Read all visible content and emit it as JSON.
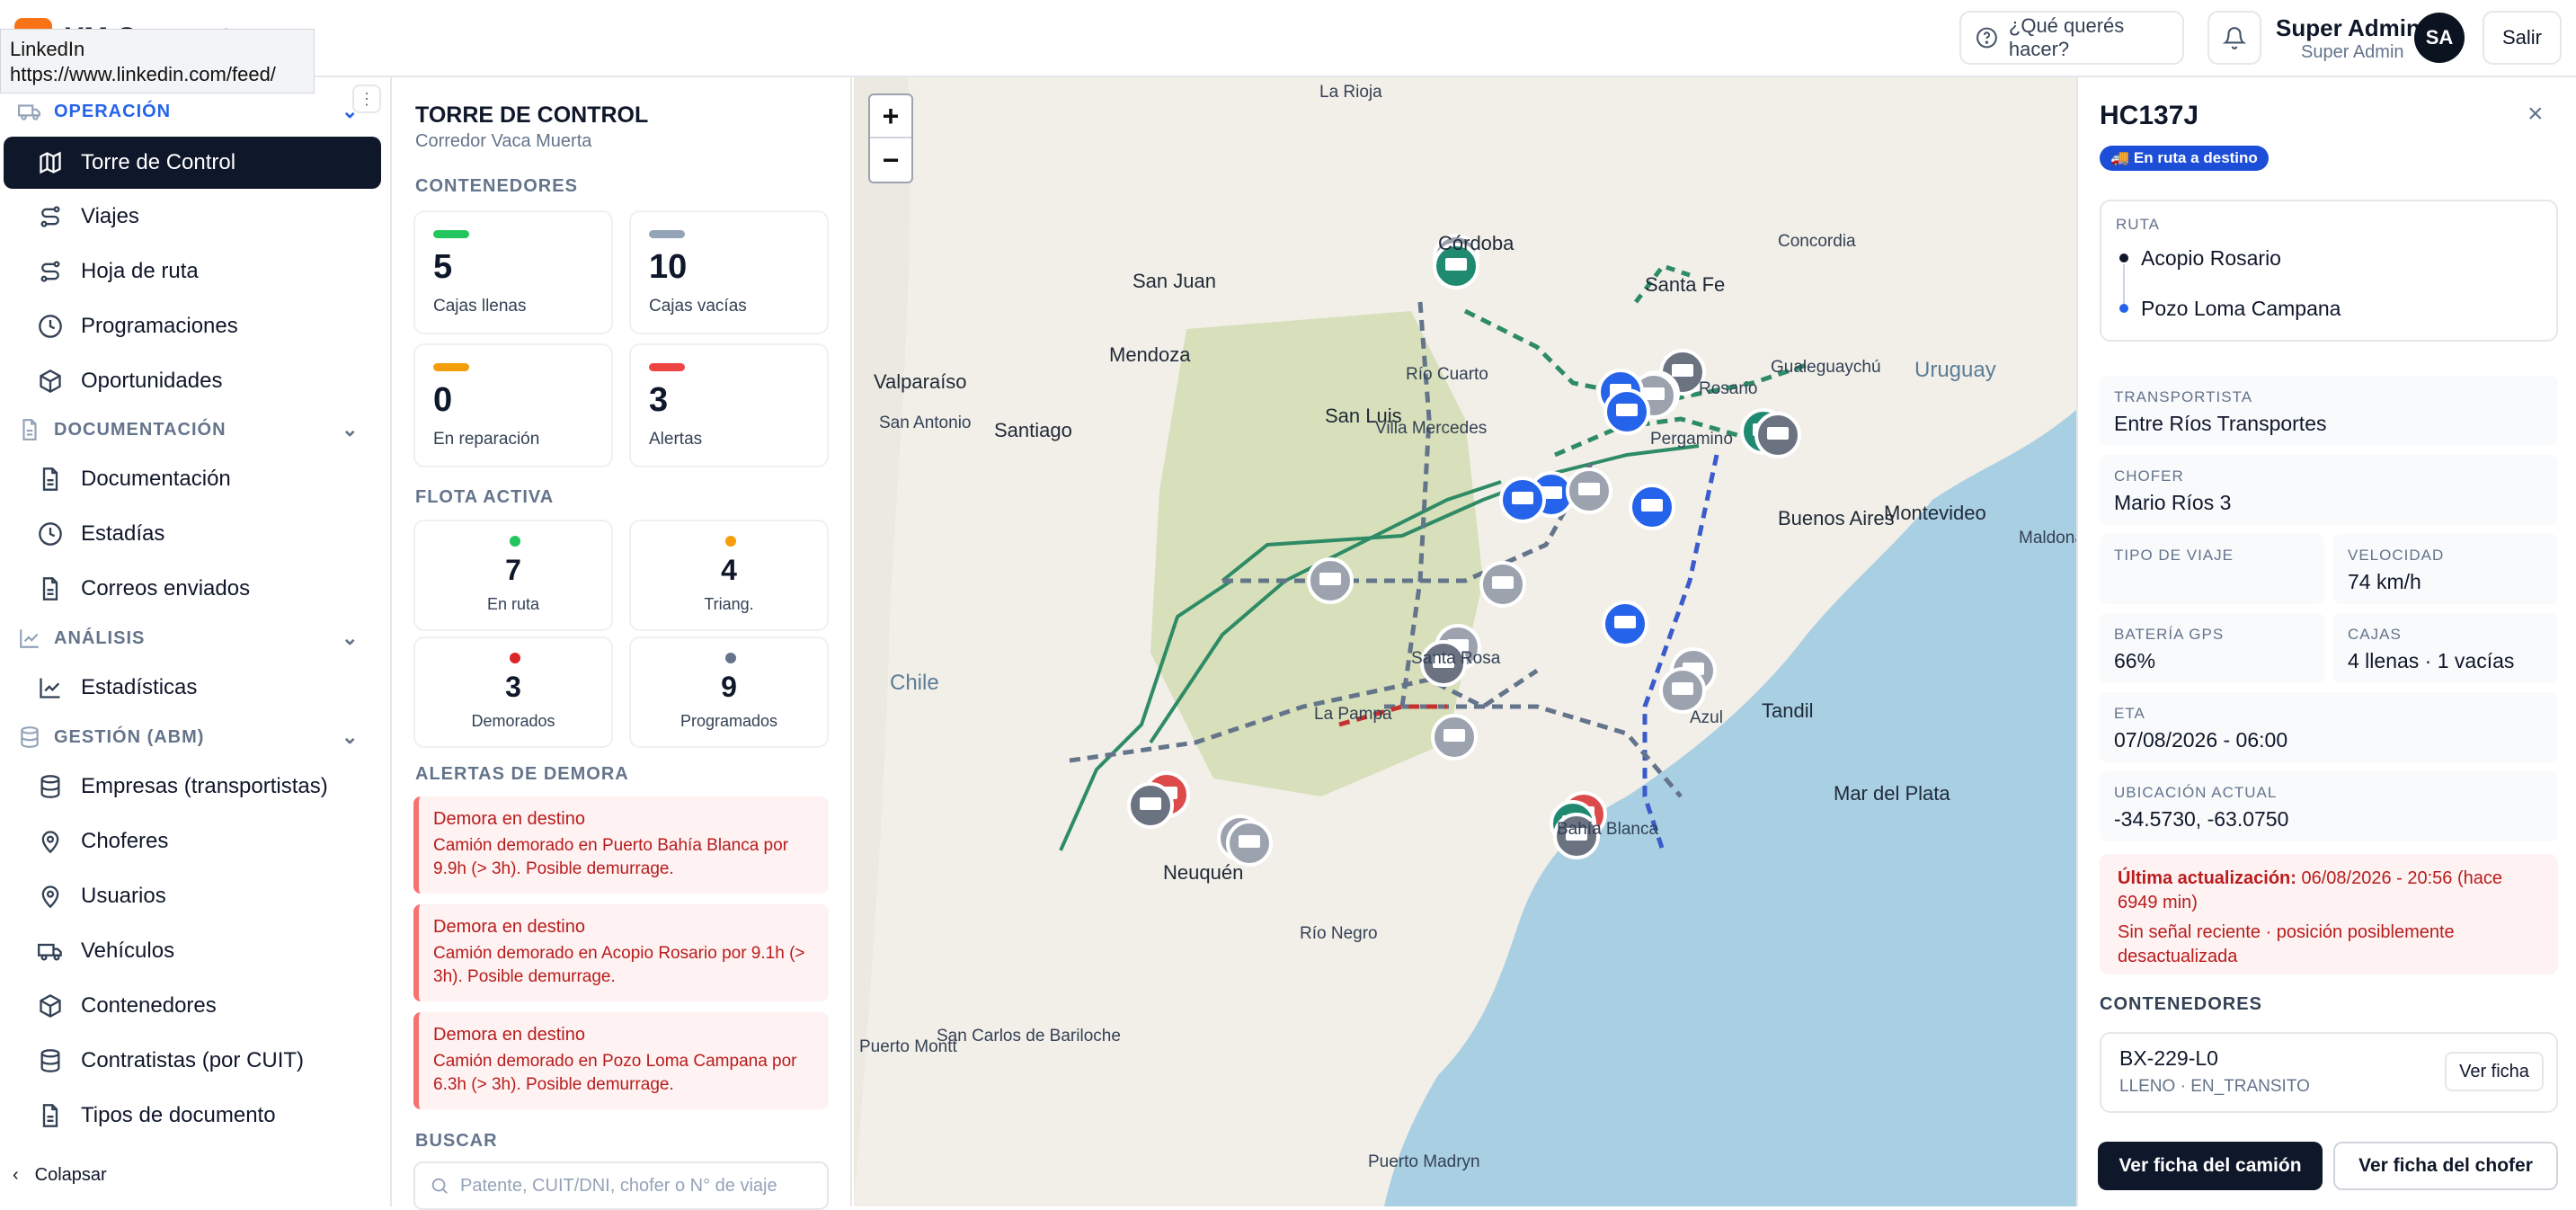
{
  "app": {
    "name": "YM Connect"
  },
  "tooltip": {
    "title": "LinkedIn",
    "url": "https://www.linkedin.com/feed/"
  },
  "header": {
    "help_label": "¿Qué querés hacer?",
    "user_name": "Super Admin",
    "user_role": "Super Admin",
    "avatar_initials": "SA",
    "logout_label": "Salir"
  },
  "sidebar": {
    "sections": {
      "operacion": "OPERACIÓN",
      "documentacion": "DOCUMENTACIÓN",
      "analisis": "ANÁLISIS",
      "gestion": "GESTIÓN (ABM)"
    },
    "items": {
      "torre": "Torre de Control",
      "viajes": "Viajes",
      "hoja": "Hoja de ruta",
      "programaciones": "Programaciones",
      "oportunidades": "Oportunidades",
      "documentacion": "Documentación",
      "estadias": "Estadías",
      "correos": "Correos enviados",
      "estadisticas": "Estadísticas",
      "empresas": "Empresas (transportistas)",
      "choferes": "Choferes",
      "usuarios": "Usuarios",
      "vehiculos": "Vehículos",
      "contenedores": "Contenedores",
      "contratistas": "Contratistas (por CUIT)",
      "tipos": "Tipos de documento"
    },
    "collapse_label": "Colapsar"
  },
  "panel": {
    "title": "TORRE DE CONTROL",
    "subtitle": "Corredor Vaca Muerta",
    "containers_label": "CONTENEDORES",
    "containers": [
      {
        "value": "5",
        "label": "Cajas llenas",
        "color": "#22c55e"
      },
      {
        "value": "10",
        "label": "Cajas vacías",
        "color": "#94a3b8"
      },
      {
        "value": "0",
        "label": "En reparación",
        "color": "#f59e0b"
      },
      {
        "value": "3",
        "label": "Alertas",
        "color": "#ef4444"
      }
    ],
    "fleet_label": "FLOTA ACTIVA",
    "fleet": [
      {
        "value": "7",
        "label": "En ruta",
        "color": "#22c55e"
      },
      {
        "value": "4",
        "label": "Triang.",
        "color": "#f59e0b"
      },
      {
        "value": "3",
        "label": "Demorados",
        "color": "#dc2626"
      },
      {
        "value": "9",
        "label": "Programados",
        "color": "#64748b"
      }
    ],
    "alerts_label": "ALERTAS DE DEMORA",
    "alerts": [
      {
        "title": "Demora en destino",
        "text": "Camión demorado en Puerto Bahía Blanca por 9.9h (> 3h). Posible demurrage."
      },
      {
        "title": "Demora en destino",
        "text": "Camión demorado en Acopio Rosario por 9.1h (> 3h). Posible demurrage."
      },
      {
        "title": "Demora en destino",
        "text": "Camión demorado en Pozo Loma Campana por 6.3h (> 3h). Posible demurrage."
      }
    ],
    "search_label": "BUSCAR",
    "search_placeholder": "Patente, CUIT/DNI, chofer o N° de viaje"
  },
  "map": {
    "zoom_in": "+",
    "zoom_out": "−",
    "labels": [
      "La Rioja",
      "Córdoba",
      "Concordia",
      "Santa Fe",
      "San Juan",
      "Uruguay",
      "Mendoza",
      "Valparaíso",
      "San Luis",
      "Río Cuarto",
      "Gualeguaychú",
      "Santiago",
      "San Antonio",
      "Villa Mercedes",
      "Rosario",
      "Pergamino",
      "Buenos Aires",
      "Montevideo",
      "Maldonado",
      "Chile",
      "La Pampa",
      "Santa Rosa",
      "Azul",
      "Tandil",
      "Mar del Plata",
      "Neuquén",
      "Río Negro",
      "Bahía Blanca",
      "San Carlos de Bariloche",
      "Puerto Madryn",
      "Puerto Montt"
    ]
  },
  "detail": {
    "plate": "HC137J",
    "close_icon": "×",
    "status": "🚚 En ruta a destino",
    "route_label": "RUTA",
    "route_origin": "Acopio Rosario",
    "route_dest": "Pozo Loma Campana",
    "carrier_label": "TRANSPORTISTA",
    "carrier": "Entre Ríos Transportes",
    "driver_label": "CHOFER",
    "driver": "Mario Ríos 3",
    "trip_type_label": "TIPO DE VIAJE",
    "trip_type": "",
    "speed_label": "VELOCIDAD",
    "speed": "74 km/h",
    "battery_label": "BATERÍA GPS",
    "battery": "66%",
    "boxes_label": "CAJAS",
    "boxes": "4 llenas · 1 vacías",
    "eta_label": "ETA",
    "eta": "07/08/2026 - 06:00",
    "location_label": "UBICACIÓN ACTUAL",
    "location": "-34.5730, -63.0750",
    "last_update_label": "Última actualización:",
    "last_update": "06/08/2026 - 20:56 (hace 6949 min)",
    "signal_warning": "Sin señal reciente · posición posiblemente desactualizada",
    "containers_label": "CONTENEDORES",
    "container_id": "BX-229-L0",
    "container_state": "LLENO · EN_TRANSITO",
    "container_btn": "Ver ficha",
    "btn_truck": "Ver ficha del camión",
    "btn_driver": "Ver ficha del chofer"
  }
}
